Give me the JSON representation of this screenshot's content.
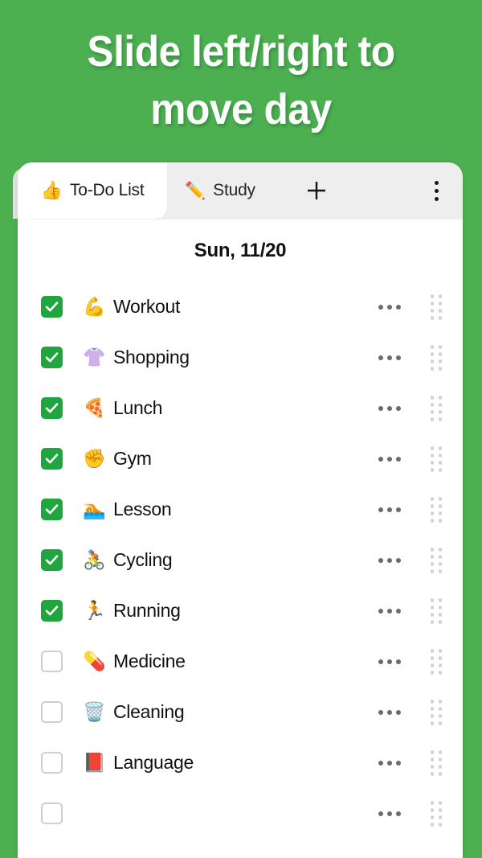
{
  "promo": {
    "headline": "Slide left/right to\nmove day"
  },
  "theme": {
    "background_green": "#4caf50",
    "checkbox_green": "#21a63f",
    "card_white": "#ffffff",
    "tabbar_gray": "#eeeeee"
  },
  "tabs": {
    "active": {
      "emoji": "👍",
      "label": "To-Do List"
    },
    "inactive": [
      {
        "emoji": "✏️",
        "label": "Study"
      }
    ],
    "add_label": "+",
    "overflow_label": "⋮"
  },
  "list": {
    "date_header": "Sun, 11/20",
    "rows": [
      {
        "emoji": "💪",
        "label": "Workout",
        "checked": true
      },
      {
        "emoji": "👚",
        "label": "Shopping",
        "checked": true
      },
      {
        "emoji": "🍕",
        "label": "Lunch",
        "checked": true
      },
      {
        "emoji": "✊",
        "label": "Gym",
        "checked": true
      },
      {
        "emoji": "🏊",
        "label": "Lesson",
        "checked": true
      },
      {
        "emoji": "🚴",
        "label": "Cycling",
        "checked": true
      },
      {
        "emoji": "🏃",
        "label": "Running",
        "checked": true
      },
      {
        "emoji": "💊",
        "label": "Medicine",
        "checked": false
      },
      {
        "emoji": "🗑️",
        "label": "Cleaning",
        "checked": false
      },
      {
        "emoji": "📕",
        "label": "Language",
        "checked": false
      },
      {
        "emoji": "",
        "label": "",
        "checked": false
      }
    ]
  }
}
